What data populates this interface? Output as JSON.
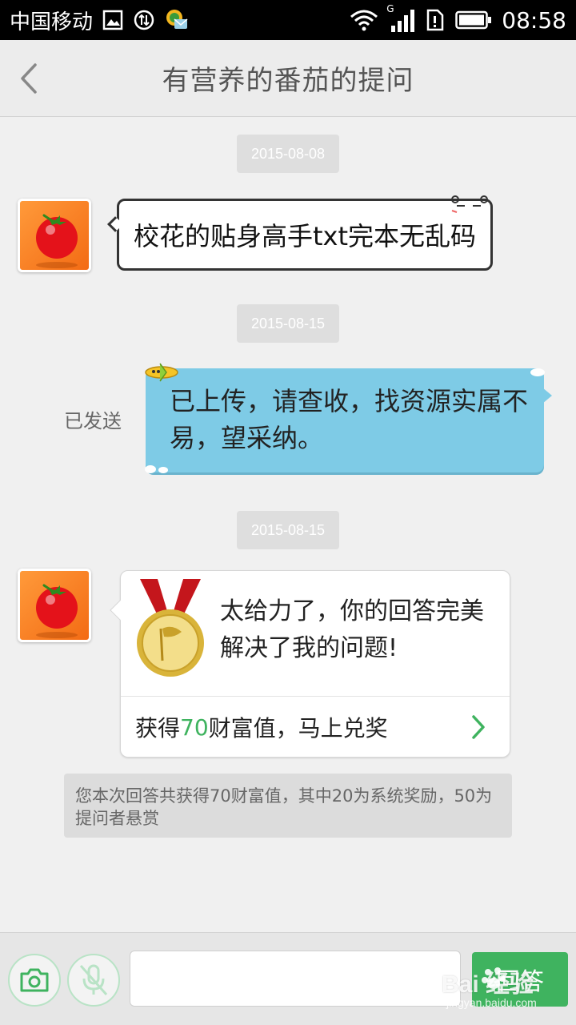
{
  "status_bar": {
    "carrier": "中国移动",
    "network": "G",
    "time": "08:58"
  },
  "header": {
    "title": "有营养的番茄的提问",
    "back_icon": "back-chevron-icon"
  },
  "messages": {
    "date1": "2015-08-08",
    "question_text": "校花的贴身高手txt完本无乱码",
    "date2": "2015-08-15",
    "sent_label": "已发送",
    "answer_text": "已上传，请查收，找资源实属不易，望采纳。",
    "date3": "2015-08-15",
    "award": {
      "message": "太给力了，你的回答完美解决了我的问题!",
      "link_prefix": "获得",
      "link_amount": "70",
      "link_suffix": "财富值，马上兑奖"
    },
    "notice": "您本次回答共获得70财富值，其中20为系统奖励，50为提问者悬赏"
  },
  "input_bar": {
    "placeholder": "",
    "answer_label": "回答"
  },
  "watermark": {
    "brand": "Bai  经验",
    "url": "jingyan.baidu.com"
  },
  "colors": {
    "accent_green": "#3fb35f",
    "answer_bubble": "#7ecbe6",
    "header_bg": "#ececec"
  }
}
